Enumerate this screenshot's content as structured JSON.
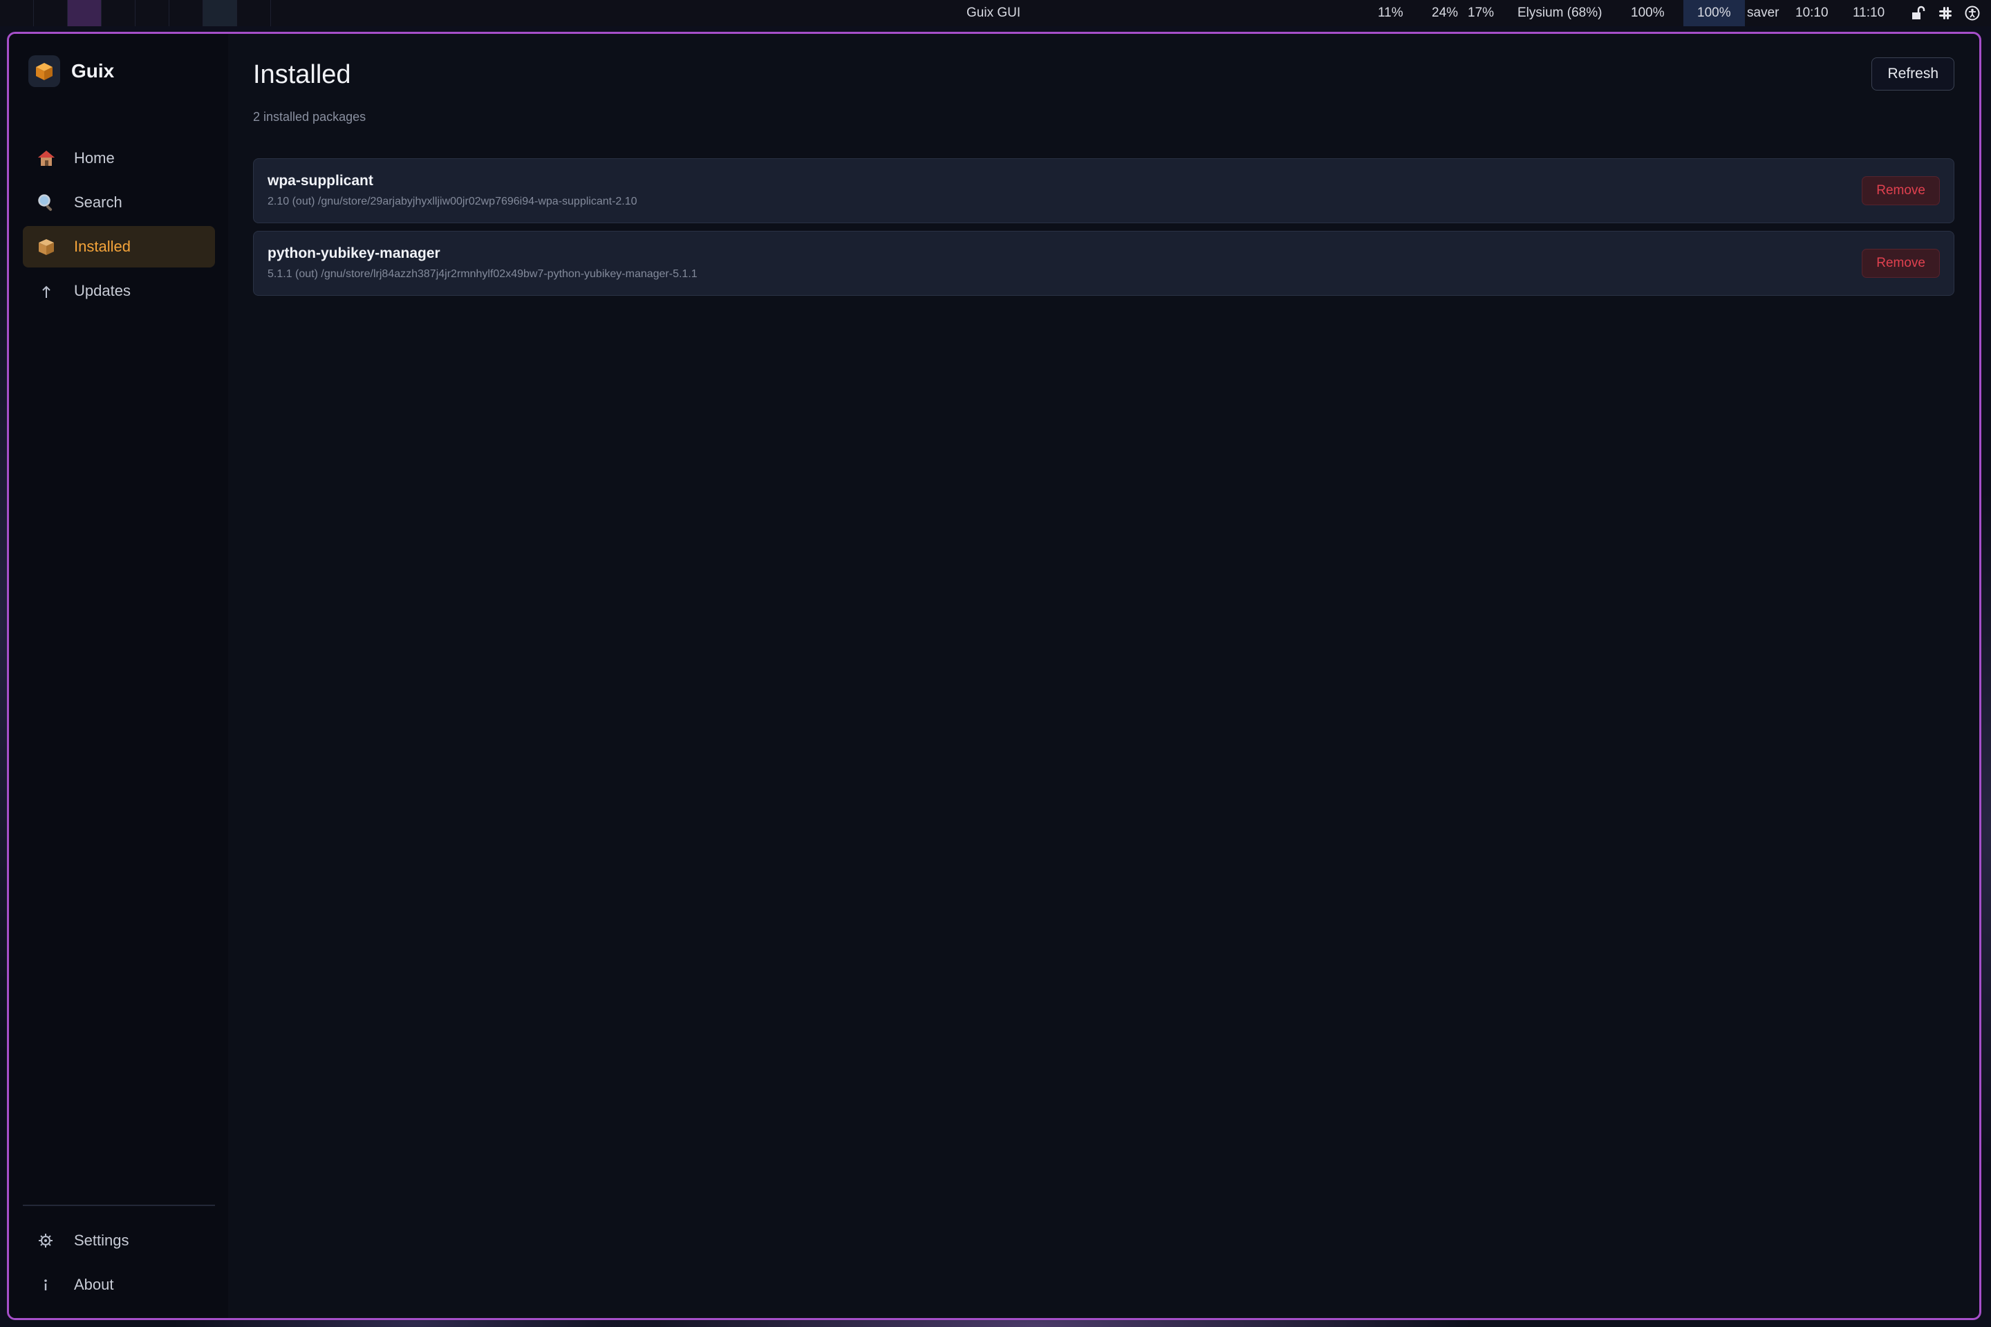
{
  "topbar": {
    "window_title": "Guix GUI",
    "stats": [
      "11%",
      "24%",
      "17%",
      "Elysium (68%)",
      "100%",
      "100%",
      "saver",
      "10:10",
      "11:10"
    ]
  },
  "app": {
    "name": "Guix"
  },
  "sidebar": {
    "items": [
      {
        "label": "Home",
        "icon": "home-icon"
      },
      {
        "label": "Search",
        "icon": "search-icon"
      },
      {
        "label": "Installed",
        "icon": "package-icon"
      },
      {
        "label": "Updates",
        "icon": "arrow-up-icon"
      }
    ],
    "bottom_items": [
      {
        "label": "Settings",
        "icon": "gear-icon"
      },
      {
        "label": "About",
        "icon": "info-icon"
      }
    ]
  },
  "main": {
    "title": "Installed",
    "subtitle": "2 installed packages",
    "refresh_label": "Refresh",
    "packages": [
      {
        "name": "wpa-supplicant",
        "meta": "2.10 (out) /gnu/store/29arjabyjhyxlljiw00jr02wp7696i94-wpa-supplicant-2.10",
        "remove_label": "Remove"
      },
      {
        "name": "python-yubikey-manager",
        "meta": "5.1.1 (out) /gnu/store/lrj84azzh387j4jr2rmnhylf02x49bw7-python-yubikey-manager-5.1.1",
        "remove_label": "Remove"
      }
    ]
  },
  "colors": {
    "accent": "#f5a43a",
    "danger": "#e0414f",
    "window_border": "#a64fc9"
  }
}
